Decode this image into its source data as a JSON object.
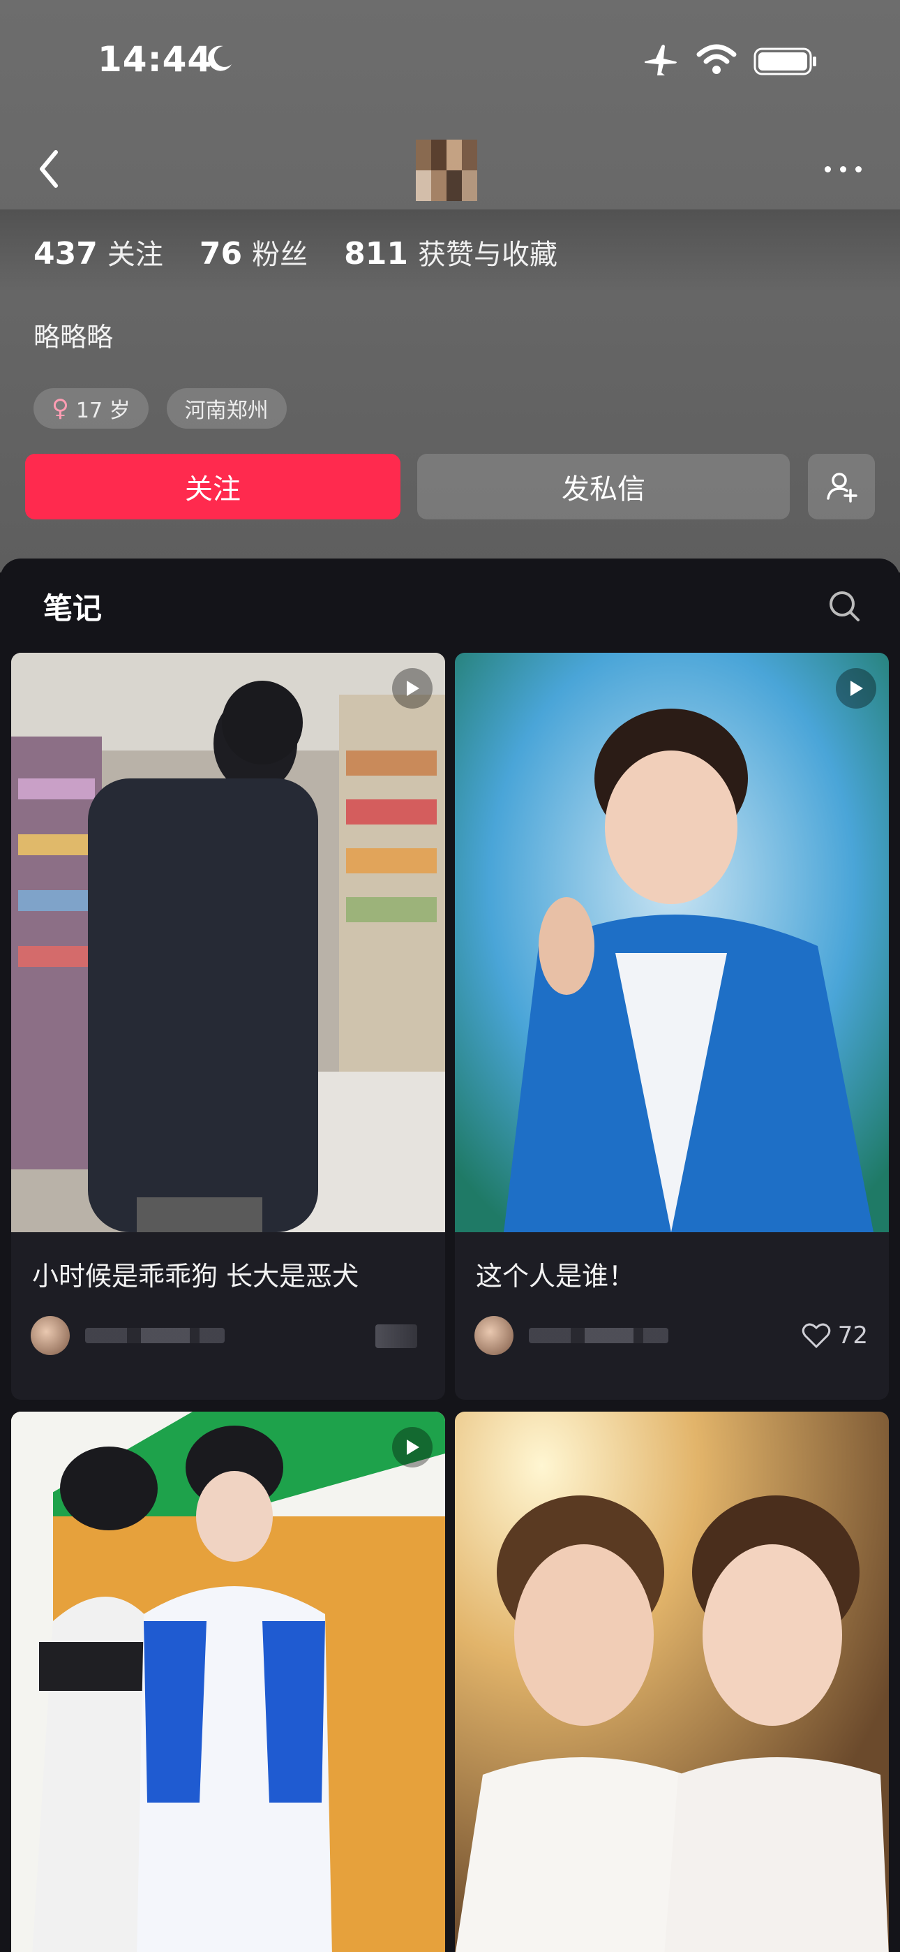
{
  "status_bar": {
    "time": "14:44",
    "icons": [
      "moon-icon",
      "airplane-icon",
      "wifi-icon",
      "battery-icon"
    ]
  },
  "nav": {
    "back_icon": "chevron-left-icon",
    "more_icon": "more-dots-icon"
  },
  "profile": {
    "stats": [
      {
        "value": "437",
        "label": "关注"
      },
      {
        "value": "76",
        "label": "粉丝"
      },
      {
        "value": "811",
        "label": "获赞与收藏"
      }
    ],
    "bio": "略略略",
    "tags": [
      "17 岁",
      "河南郑州"
    ],
    "gender_symbol": "♀"
  },
  "actions": {
    "follow": "关注",
    "message": "发私信",
    "add_user_icon": "add-user-icon"
  },
  "notes": {
    "tab_title": "笔记",
    "search_icon": "search-icon",
    "cards": [
      {
        "title": "小时候是乖乖狗 长大是恶犬",
        "likes": "",
        "has_video": true
      },
      {
        "title": "这个人是谁！",
        "likes": "72",
        "has_video": true
      },
      {
        "title": "",
        "likes": "",
        "has_video": true
      },
      {
        "title": "",
        "likes": "",
        "has_video": false
      }
    ]
  },
  "colors": {
    "accent": "#ff2a4e",
    "header_bg": "#6a6a6a",
    "panel_bg": "#141419",
    "card_bg": "#1d1d24"
  }
}
